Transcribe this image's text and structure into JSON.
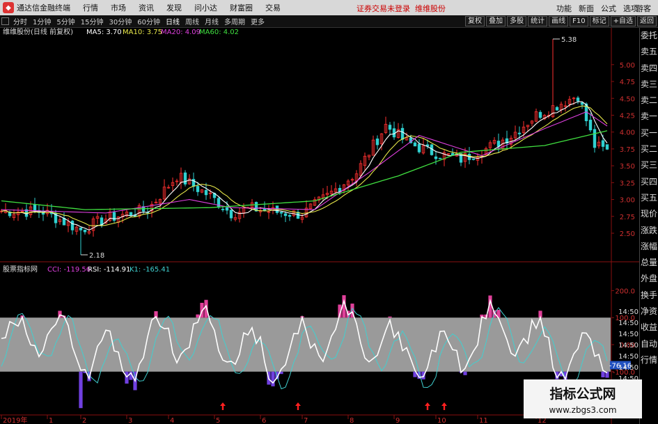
{
  "titlebar": {
    "app_name": "通达信金融终端",
    "menus": [
      "行情",
      "市场",
      "资讯",
      "发现",
      "问小达",
      "财富圈",
      "交易"
    ],
    "notice": "证券交易未登录",
    "notice2": "维维股份",
    "right_menus": [
      "功能",
      "新面",
      "公式",
      "选项"
    ],
    "guest": "游客"
  },
  "toolbar": {
    "timeframes": [
      "分时",
      "1分钟",
      "5分钟",
      "15分钟",
      "30分钟",
      "60分钟",
      "日线",
      "周线",
      "月线",
      "多周期",
      "更多"
    ],
    "active": "日线",
    "right_buttons": [
      "复权",
      "叠加",
      "多股",
      "统计",
      "画线",
      "F10",
      "标记",
      "+自选",
      "返回"
    ]
  },
  "sidebar": {
    "items": [
      "委托",
      "卖五",
      "卖四",
      "卖三",
      "卖二",
      "卖一",
      "买一",
      "买二",
      "买三",
      "买四",
      "买五",
      "现价",
      "涨跌",
      "涨幅",
      "总量",
      "外盘",
      "换手",
      "净资",
      "收益",
      "自动",
      "行情"
    ]
  },
  "chart_data": {
    "type": "candlestick",
    "main": {
      "header": "维维股份(日线 前复权)",
      "ma": [
        {
          "name": "MA5",
          "value": "3.70",
          "color": "#ffffff"
        },
        {
          "name": "MA10",
          "value": "3.75",
          "color": "#e8e84a"
        },
        {
          "name": "MA20",
          "value": "4.09",
          "color": "#e040e0"
        },
        {
          "name": "MA60",
          "value": "4.02",
          "color": "#40e040"
        }
      ],
      "ylim": [
        2.18,
        5.38
      ],
      "yticks": [
        "5.00",
        "4.75",
        "4.50",
        "4.25",
        "4.00",
        "3.75",
        "3.50",
        "3.25",
        "3.00",
        "2.75",
        "2.50"
      ],
      "annotations": [
        {
          "text": "5.38",
          "value": 5.38,
          "x_index": 132
        },
        {
          "text": "2.18",
          "value": 2.18,
          "x_index": 19
        }
      ],
      "close_anchor_points": [
        [
          0,
          2.83
        ],
        [
          10,
          2.82
        ],
        [
          19,
          2.55
        ],
        [
          25,
          2.72
        ],
        [
          35,
          2.85
        ],
        [
          42,
          3.35
        ],
        [
          50,
          3.05
        ],
        [
          55,
          2.8
        ],
        [
          60,
          2.87
        ],
        [
          65,
          2.82
        ],
        [
          72,
          2.78
        ],
        [
          78,
          3.05
        ],
        [
          85,
          3.4
        ],
        [
          92,
          4.1
        ],
        [
          97,
          3.85
        ],
        [
          102,
          3.72
        ],
        [
          110,
          3.6
        ],
        [
          116,
          3.75
        ],
        [
          122,
          3.95
        ],
        [
          128,
          4.25
        ],
        [
          133,
          4.4
        ],
        [
          138,
          4.55
        ],
        [
          142,
          3.8
        ],
        [
          145,
          3.72
        ]
      ],
      "ma60_anchor_points": [
        [
          0,
          2.98
        ],
        [
          20,
          2.85
        ],
        [
          50,
          2.88
        ],
        [
          75,
          2.98
        ],
        [
          95,
          3.35
        ],
        [
          110,
          3.7
        ],
        [
          130,
          3.8
        ],
        [
          145,
          4.02
        ]
      ],
      "ma20_anchor_points": [
        [
          0,
          2.85
        ],
        [
          25,
          2.8
        ],
        [
          45,
          3.0
        ],
        [
          55,
          2.88
        ],
        [
          75,
          2.85
        ],
        [
          88,
          3.4
        ],
        [
          100,
          3.95
        ],
        [
          115,
          3.65
        ],
        [
          130,
          4.05
        ],
        [
          140,
          4.3
        ],
        [
          145,
          4.09
        ]
      ]
    },
    "indicator": {
      "name": "股票指标网",
      "values_text": [
        {
          "label": "CCI",
          "value": "-119.56",
          "color": "#e040e0"
        },
        {
          "label": "RSI",
          "value": "-114.91",
          "color": "#ffffff"
        },
        {
          "label": "K1",
          "value": "-165.41",
          "color": "#40d0d0"
        }
      ],
      "ylim": [
        -250,
        250
      ],
      "yticks": [
        "200.0",
        "100.0",
        "0.00",
        "-100.0",
        "-200.0"
      ],
      "band": [
        -100,
        100
      ],
      "current_tag": "-76.16",
      "arrows_x_index": [
        53,
        71,
        102,
        106,
        143
      ]
    },
    "xlabels": [
      "2019年",
      "1",
      "2",
      "3",
      "4",
      "5",
      "6",
      "7",
      "8",
      "9",
      "10",
      "11",
      "12"
    ],
    "xlabel_indices": [
      0,
      11,
      19,
      30,
      40,
      51,
      62,
      72,
      83,
      94,
      104,
      114,
      128
    ]
  },
  "right_time_labels": [
    "14:50",
    "14:50",
    "14:50",
    "14:50",
    "14:50",
    "14:50",
    "14:50"
  ],
  "watermark": {
    "title": "指标公式网",
    "url": "www.zbgs3.com"
  }
}
